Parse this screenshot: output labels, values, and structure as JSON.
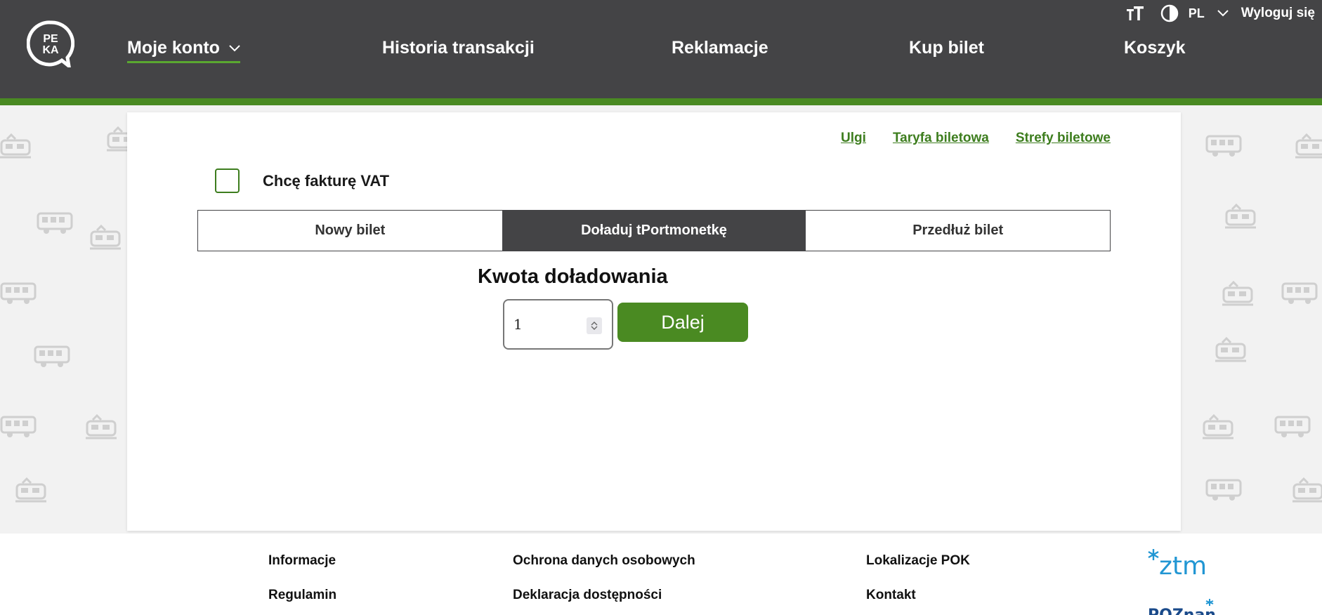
{
  "header": {
    "logo_text_top": "PE",
    "logo_text_bottom": "KA",
    "utils": {
      "font_size_icon": "text-size-icon",
      "contrast_icon": "contrast-icon",
      "language": "PL",
      "logout": "Wyloguj się"
    },
    "nav": [
      {
        "label": "Moje konto",
        "active": true
      },
      {
        "label": "Historia transakcji"
      },
      {
        "label": "Reklamacje"
      },
      {
        "label": "Kup bilet"
      },
      {
        "label": "Koszyk"
      }
    ]
  },
  "card": {
    "links": [
      "Ulgi",
      "Taryfa biletowa",
      "Strefy biletowe"
    ],
    "vat_label": "Chcę fakturę VAT",
    "vat_checked": false,
    "tabs": [
      {
        "label": "Nowy bilet"
      },
      {
        "label": "Doładuj tPortmonetkę",
        "active": true
      },
      {
        "label": "Przedłuż bilet"
      }
    ],
    "amount_title": "Kwota doładowania",
    "amount_value": "1",
    "next_label": "Dalej"
  },
  "footer": {
    "links": [
      "Informacje",
      "Regulamin",
      "Ochrona danych osobowych",
      "Deklaracja dostępności",
      "Lokalizacje POK",
      "Kontakt"
    ],
    "ztm_logo_text": "ztm",
    "poznan_logo_text": "POZnan"
  },
  "colors": {
    "header_bg": "#444446",
    "accent_green": "#4a8a22",
    "link_green": "#3d7d1e"
  }
}
